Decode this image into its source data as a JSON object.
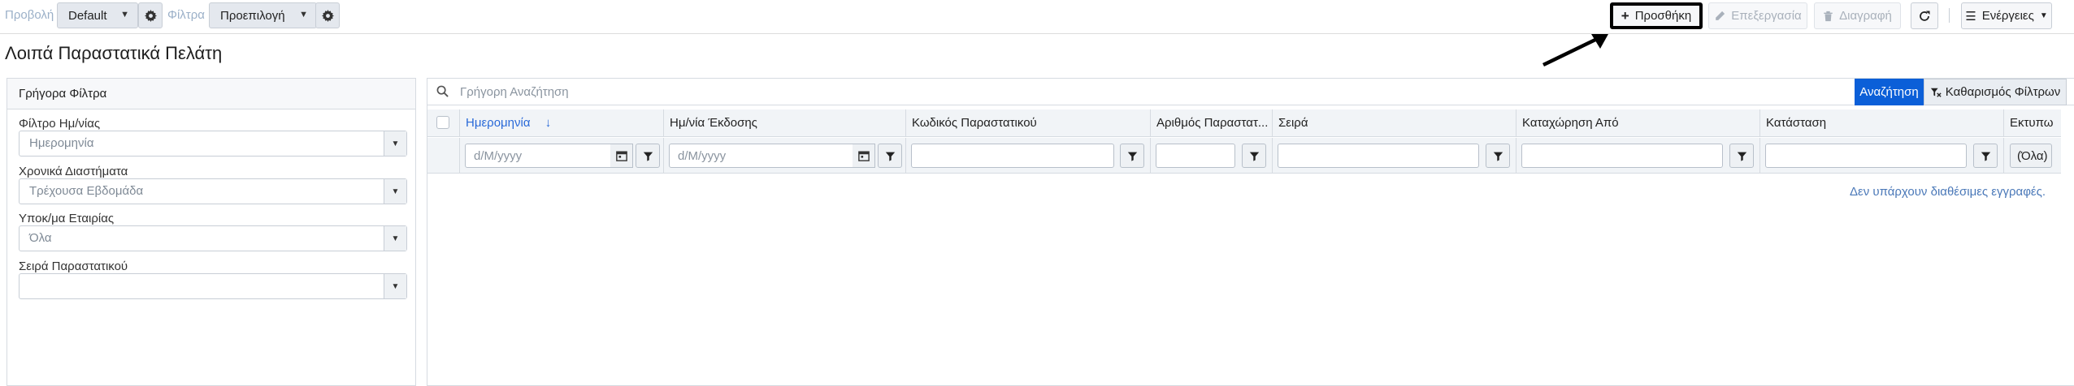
{
  "toolbar": {
    "view_label": "Προβολή",
    "view_value": "Default",
    "filter_label": "Φίλτρα",
    "filter_value": "Προεπιλογή",
    "add_label": "Προσθήκη",
    "edit_label": "Επεξεργασία",
    "delete_label": "Διαγραφή",
    "actions_label": "Ενέργειες"
  },
  "page": {
    "title": "Λοιπά Παραστατικά Πελάτη"
  },
  "quick_filters": {
    "title": "Γρήγορα Φίλτρα",
    "fields": [
      {
        "label": "Φίλτρο Ημ/νίας",
        "value": "Ημερομηνία"
      },
      {
        "label": "Χρονικά Διαστήματα",
        "value": "Τρέχουσα Εβδομάδα"
      },
      {
        "label": "Υποκ/μα Εταιρίας",
        "value": "Όλα"
      },
      {
        "label": "Σειρά Παραστατικού",
        "value": ""
      }
    ]
  },
  "grid": {
    "search_placeholder": "Γρήγορη Αναζήτηση",
    "search_button": "Αναζήτηση",
    "clear_filters_button": "Καθαρισμός Φίλτρων",
    "columns": [
      "Ημερομηνία",
      "Ημ/νία Έκδοσης",
      "Κωδικός Παραστατικού",
      "Αριθμός Παραστατ...",
      "Σειρά",
      "Καταχώρηση Από",
      "Κατάσταση",
      "Εκτυπω"
    ],
    "date_placeholder": "d/M/yyyy",
    "print_filter_value": "(Όλα)",
    "no_records": "Δεν υπάρχουν διαθέσιμες εγγραφές."
  },
  "colors": {
    "primary": "#0b5fd8",
    "sorted_header": "#2a6ad8",
    "muted_label": "#9bb0c8"
  }
}
